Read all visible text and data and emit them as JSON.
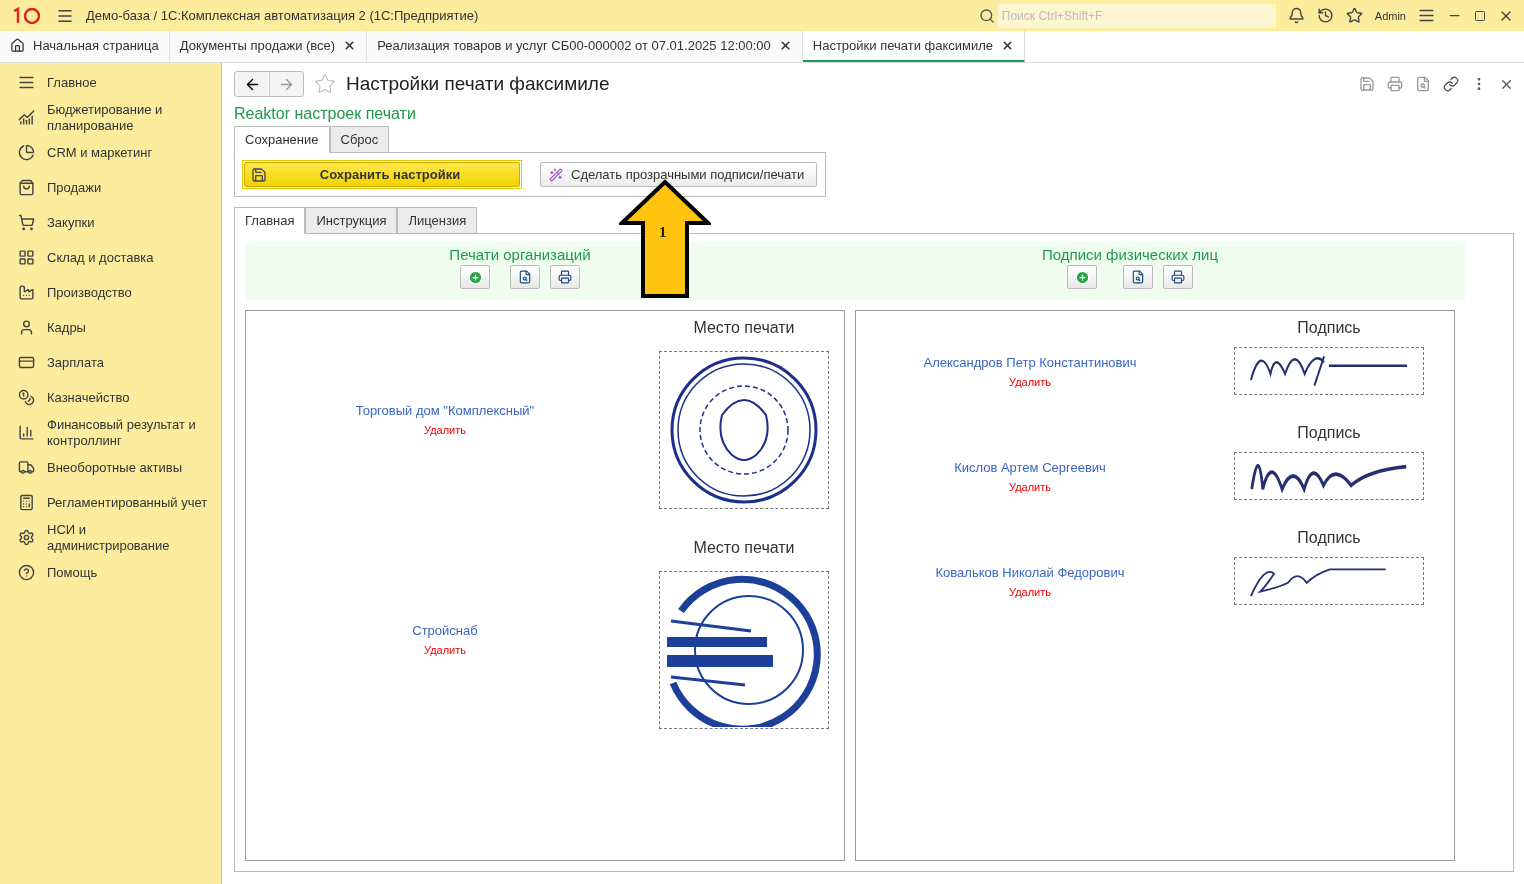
{
  "titlebar": {
    "title": "Демо-база / 1С:Комплексная автоматизация 2  (1С:Предприятие)",
    "search": {
      "placeholder": "Поиск Ctrl+Shift+F"
    },
    "user": "Admin"
  },
  "open_tabs": [
    {
      "label": "Начальная страница",
      "kind": "home",
      "selected": false
    },
    {
      "label": "Документы продажи (все)",
      "kind": "doc",
      "selected": false
    },
    {
      "label": "Реализация товаров и услуг СБ00-000002 от 07.01.2025 12:00:00",
      "kind": "doc",
      "selected": false
    },
    {
      "label": "Настройки печати факсимиле",
      "kind": "doc",
      "selected": true
    }
  ],
  "sidebar": {
    "items": [
      {
        "label": "Главное"
      },
      {
        "label": "Бюджетирование и планирование"
      },
      {
        "label": "CRM и маркетинг"
      },
      {
        "label": "Продажи"
      },
      {
        "label": "Закупки"
      },
      {
        "label": "Склад и доставка"
      },
      {
        "label": "Производство"
      },
      {
        "label": "Кадры"
      },
      {
        "label": "Зарплата"
      },
      {
        "label": "Казначейство"
      },
      {
        "label": "Финансовый результат и контроллинг"
      },
      {
        "label": "Внеоборотные активы"
      },
      {
        "label": "Регламентированный учет"
      },
      {
        "label": "НСИ и администрирование"
      },
      {
        "label": "Помощь"
      }
    ]
  },
  "form": {
    "title": "Настройки печати факсимиле",
    "subtitle": "Reaktor настроек печати",
    "top_tabs": [
      {
        "label": "Сохранение",
        "selected": true
      },
      {
        "label": "Сброс",
        "selected": false
      }
    ],
    "save_button": "Сохранить настройки",
    "transparent_button": "Сделать прозрачными подписи/печати",
    "annotation": {
      "label": "1"
    },
    "main_tabs": [
      {
        "label": "Главная",
        "selected": true
      },
      {
        "label": "Инструкция",
        "selected": false
      },
      {
        "label": "Лицензия",
        "selected": false
      }
    ],
    "stamps_header": "Печати организаций",
    "signatures_header": "Подписи физических лиц",
    "stamps": [
      {
        "name": "Торговый дом \"Комплексный\"",
        "delete": "Удалить",
        "caption": "Место печати",
        "kind": "round"
      },
      {
        "name": "Стройснаб",
        "delete": "Удалить",
        "caption": "Место печати",
        "kind": "cut"
      }
    ],
    "signatures": [
      {
        "name": "Александров Петр Константинович",
        "delete": "Удалить",
        "caption": "Подпись"
      },
      {
        "name": "Кислов Артем Сергеевич",
        "delete": "Удалить",
        "caption": "Подпись"
      },
      {
        "name": "Ковальков Николай Федорович",
        "delete": "Удалить",
        "caption": "Подпись"
      }
    ]
  }
}
